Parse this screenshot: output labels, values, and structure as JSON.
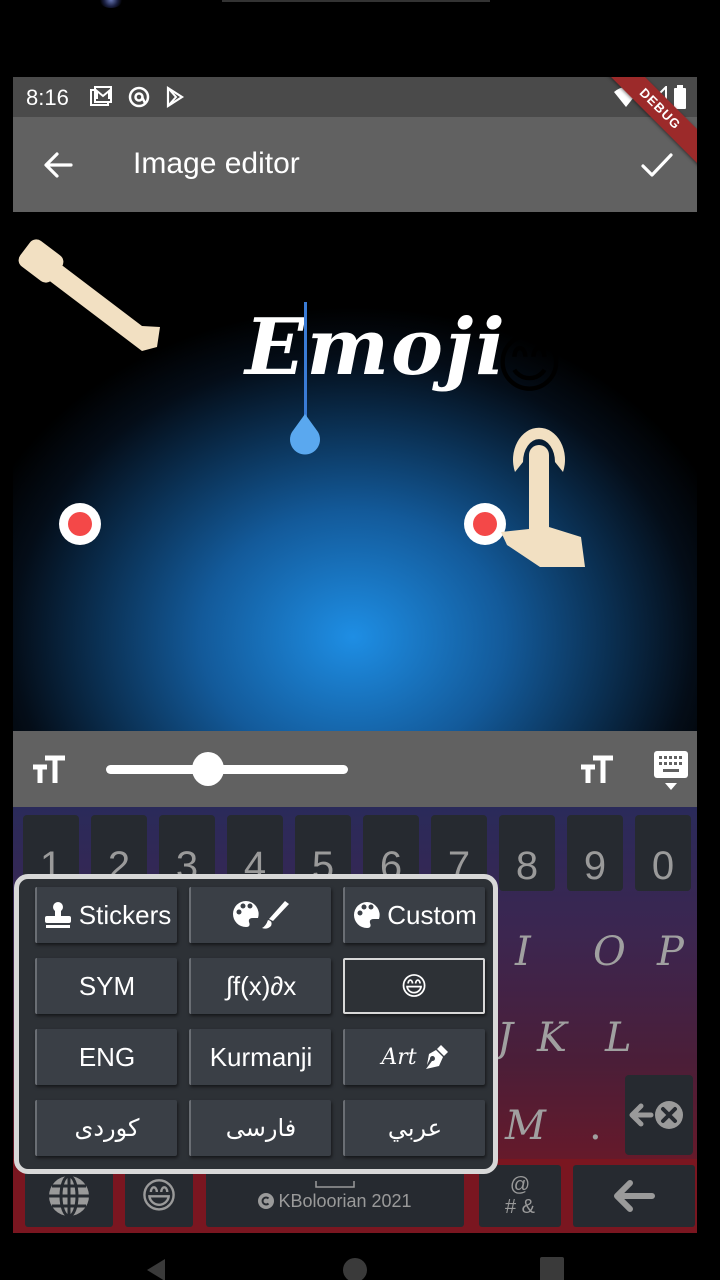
{
  "status_bar": {
    "time": "8:16",
    "left_icons": [
      "gallery-icon",
      "at-sign-icon",
      "play-store-icon"
    ],
    "right_icons": [
      "wifi-icon",
      "signal-icon",
      "battery-icon"
    ]
  },
  "debug_banner": "DEBUG",
  "app_bar": {
    "title": "Image editor",
    "back_icon": "arrow-left-icon",
    "confirm_icon": "check-icon"
  },
  "canvas": {
    "text": "Emoji",
    "emoji": "😊",
    "tools": [
      "pencil-icon",
      "tap-hand-icon"
    ]
  },
  "font_toolbar": {
    "font_size_slider_value": 0.41,
    "left_icon": "text-size-icon",
    "right_icon": "text-size-icon",
    "keyboard_toggle_icon": "keyboard-hide-icon"
  },
  "keyboard": {
    "number_row": [
      "1",
      "2",
      "3",
      "4",
      "5",
      "6",
      "7",
      "8",
      "9",
      "0"
    ],
    "visible_letters": [
      "I",
      "O",
      "P",
      "J",
      "K",
      "L",
      "M",
      "."
    ],
    "bottom_row": {
      "globe_icon": "globe-icon",
      "emoji": "😄",
      "space_label": "KBoloorian 2021",
      "symbols_top": "@",
      "symbols_bottom": "# &",
      "enter_icon": "arrow-left-icon"
    },
    "delete_icon": "backspace-icon"
  },
  "popup_menu": {
    "items": [
      {
        "label": "Stickers",
        "icon": "stamp-icon"
      },
      {
        "label": "",
        "icon": "palette-brush-icon"
      },
      {
        "label": "Custom",
        "icon": "palette-icon"
      },
      {
        "label": "SYM",
        "icon": ""
      },
      {
        "label": "∫f(x)∂x",
        "icon": ""
      },
      {
        "label": "😄",
        "icon": "",
        "selected": true
      },
      {
        "label": "ENG",
        "icon": ""
      },
      {
        "label": "Kurmanji",
        "icon": ""
      },
      {
        "label": "Art",
        "icon": "pen-nib-icon"
      },
      {
        "label": "کوردی",
        "icon": ""
      },
      {
        "label": "فارسی",
        "icon": ""
      },
      {
        "label": "عربي",
        "icon": ""
      }
    ]
  },
  "nav_bar": {
    "icons": [
      "nav-back-icon",
      "nav-home-icon",
      "nav-recents-icon"
    ]
  }
}
